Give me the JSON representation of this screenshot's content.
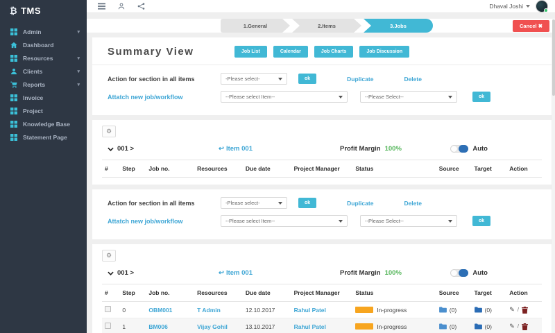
{
  "colors": {
    "sidebar-bg": "#2e3744",
    "teal": "#3bc0d8",
    "accent": "#41b8d5",
    "link": "#3ea6d5",
    "red": "#f05050",
    "orange": "#f7a51f",
    "green": "#53b559",
    "blue": "#2d6fb5"
  },
  "icons": {
    "gear": "⚙",
    "reply": "↩",
    "close": "✖",
    "pencil": "✎",
    "slash": "/"
  },
  "sidebar": {
    "logo": "₿",
    "brand": "TMS",
    "items": [
      {
        "label": "Admin",
        "icon": "grid",
        "chevron": "▾"
      },
      {
        "label": "Dashboard",
        "icon": "home",
        "chevron": ""
      },
      {
        "label": "Resources",
        "icon": "grid",
        "chevron": "▾"
      },
      {
        "label": "Clients",
        "icon": "user",
        "chevron": "▾"
      },
      {
        "label": "Reports",
        "icon": "cart",
        "chevron": "▾"
      },
      {
        "label": "Invoice",
        "icon": "grid",
        "chevron": ""
      },
      {
        "label": "Project",
        "icon": "grid",
        "chevron": ""
      },
      {
        "label": "Knowledge Base",
        "icon": "grid",
        "chevron": ""
      },
      {
        "label": "Statement Page",
        "icon": "grid",
        "chevron": ""
      }
    ]
  },
  "topbar": {
    "user": "Dhaval Joshi"
  },
  "wizard": {
    "steps": [
      {
        "label": "1.General"
      },
      {
        "label": "2.Items"
      },
      {
        "label": "3.Jobs"
      }
    ],
    "cancel_label": "Cancel"
  },
  "summary": {
    "title": "Summary View",
    "buttons": [
      "Job List",
      "Calendar",
      "Job Charts",
      "Job Discussion"
    ]
  },
  "action_block": {
    "action_label": "Action for section in all items",
    "action_select": "-Please select-",
    "ok_label": "ok",
    "duplicate_label": "Duplicate",
    "delete_label": "Delete",
    "attach_label": "Attatch new job/workflow",
    "item_select": "--Please select Item--",
    "workflow_select": "--Please Select--"
  },
  "section": {
    "code": "001 >",
    "item": "Item 001",
    "profit_label": "Profit Margin",
    "profit_value": "100%",
    "auto_label": "Auto"
  },
  "table": {
    "headers": [
      "#",
      "Step",
      "Job no.",
      "Resources",
      "Due date",
      "Project Manager",
      "Status",
      "Source",
      "Target",
      "Action"
    ],
    "rows": [
      {
        "step": "0",
        "job_no": "OBM001",
        "resources": "T Admin",
        "due_date": "12.10.2017",
        "pm": "Rahul Patel",
        "status": "In-progress",
        "source": "(0)",
        "target": "(0)"
      },
      {
        "step": "1",
        "job_no": "BM006",
        "resources": "Vijay Gohil",
        "due_date": "13.10.2017",
        "pm": "Rahul Patel",
        "status": "In-progress",
        "source": "(0)",
        "target": "(0)"
      }
    ]
  }
}
